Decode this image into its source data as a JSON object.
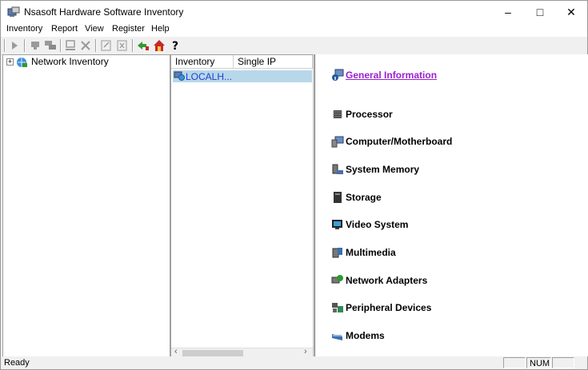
{
  "window": {
    "title": "Nsasoft Hardware Software Inventory",
    "controls": {
      "minimize": "–",
      "maximize": "□",
      "close": "✕"
    }
  },
  "menu": [
    "Inventory",
    "Report",
    "View",
    "Register",
    "Help"
  ],
  "toolbar": {
    "buttons": [
      "run-icon",
      "scan-icon",
      "scan-network-icon",
      "computer-icon",
      "delete-icon",
      "edit-icon",
      "remove-icon",
      "import-icon",
      "home-icon",
      "help-icon"
    ]
  },
  "tree": {
    "root_label": "Network Inventory",
    "expander": "+"
  },
  "list": {
    "columns": [
      "Inventory",
      "Single IP"
    ],
    "rows": [
      {
        "name": "LOCALH..."
      }
    ]
  },
  "details": {
    "categories": [
      "General Information",
      "Processor",
      "Computer/Motherboard",
      "System Memory",
      "Storage",
      "Video System",
      "Multimedia",
      "Network Adapters",
      "Peripheral Devices",
      "Modems"
    ]
  },
  "status": {
    "text": "Ready",
    "num": "NUM"
  },
  "colors": {
    "link": "#9b1fd1",
    "selection": "#b8d7ea",
    "item_text": "#1f3fd0"
  }
}
